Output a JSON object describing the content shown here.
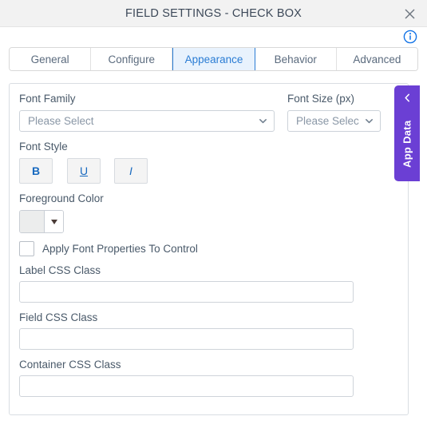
{
  "window": {
    "title": "FIELD SETTINGS - CHECK BOX",
    "close_icon": "close-icon",
    "info_icon": "info-icon"
  },
  "tabs": [
    {
      "label": "General",
      "active": false
    },
    {
      "label": "Configure",
      "active": false
    },
    {
      "label": "Appearance",
      "active": true
    },
    {
      "label": "Behavior",
      "active": false
    },
    {
      "label": "Advanced",
      "active": false
    }
  ],
  "form": {
    "font_family": {
      "label": "Font Family",
      "value": "Please Select",
      "chevron_icon": "chevron-down-icon"
    },
    "font_size": {
      "label": "Font Size (px)",
      "value": "Please Select",
      "chevron_icon": "chevron-down-icon"
    },
    "font_style": {
      "label": "Font Style",
      "buttons": [
        {
          "label": "B",
          "name": "bold"
        },
        {
          "label": "U",
          "name": "underline"
        },
        {
          "label": "I",
          "name": "italic"
        }
      ]
    },
    "foreground_color": {
      "label": "Foreground Color",
      "swatch_color": "#eceded",
      "caret_icon": "caret-down-icon"
    },
    "apply_font_properties": {
      "label": "Apply Font Properties To Control",
      "checked": false
    },
    "label_css_class": {
      "label": "Label CSS Class",
      "value": "",
      "placeholder": ""
    },
    "field_css_class": {
      "label": "Field CSS Class",
      "value": "",
      "placeholder": ""
    },
    "container_css_class": {
      "label": "Container CSS Class",
      "value": "",
      "placeholder": ""
    }
  },
  "app_data_tab": {
    "label": "App Data",
    "chevron_icon": "chevron-left-icon",
    "color": "#6b3fd4"
  },
  "colors": {
    "accent_blue": "#2a7cd4",
    "active_tab_bg": "#e8f2fd",
    "titlebar_bg": "#f2f2f2",
    "text": "#3c4858",
    "purple": "#6b3fd4"
  }
}
